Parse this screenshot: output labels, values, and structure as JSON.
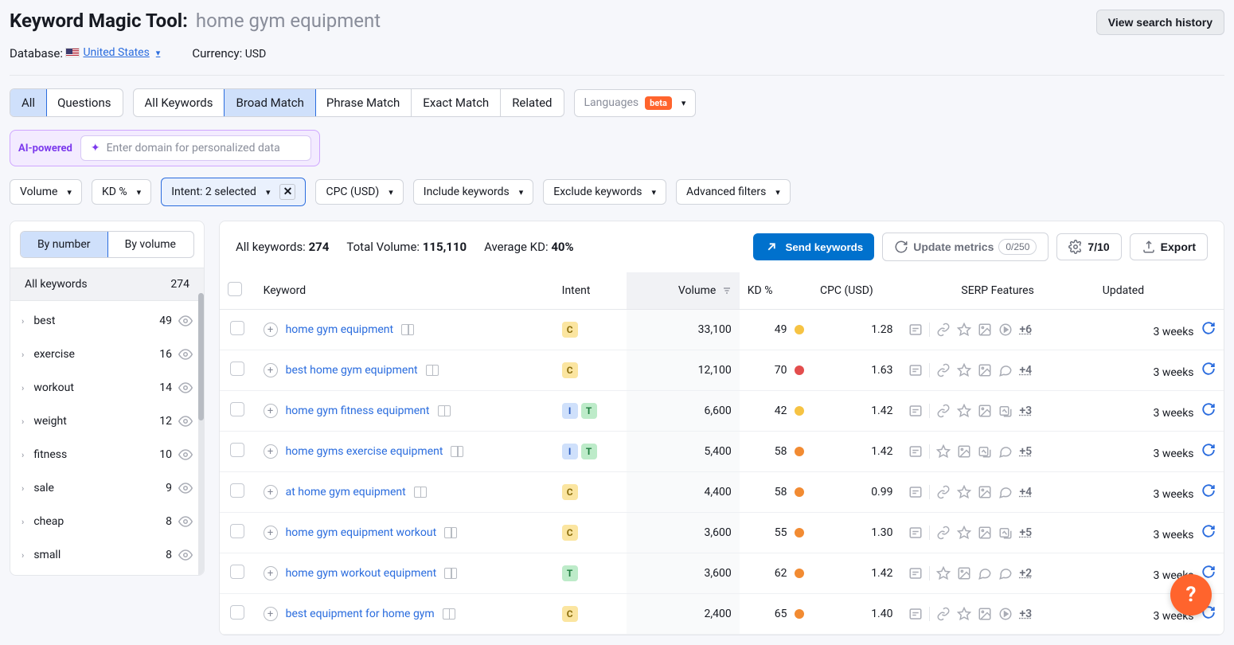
{
  "header": {
    "tool_name": "Keyword Magic Tool:",
    "query": "home gym equipment",
    "view_history": "View search history",
    "database_label": "Database:",
    "database_value": "United States",
    "currency_label": "Currency:",
    "currency_value": "USD"
  },
  "tabs": {
    "scope": [
      "All",
      "Questions"
    ],
    "scope_active": 0,
    "match": [
      "All Keywords",
      "Broad Match",
      "Phrase Match",
      "Exact Match",
      "Related"
    ],
    "match_active": 1,
    "languages": "Languages",
    "beta": "beta"
  },
  "ai": {
    "label": "AI-powered",
    "placeholder": "Enter domain for personalized data"
  },
  "filters": {
    "volume": "Volume",
    "kd": "KD %",
    "intent": "Intent: 2 selected",
    "cpc": "CPC (USD)",
    "include": "Include keywords",
    "exclude": "Exclude keywords",
    "advanced": "Advanced filters"
  },
  "sidebar": {
    "by_number": "By number",
    "by_volume": "By volume",
    "view_active": "number",
    "all_keywords_label": "All keywords",
    "all_keywords_count": "274",
    "groups": [
      {
        "name": "best",
        "count": "49"
      },
      {
        "name": "exercise",
        "count": "16"
      },
      {
        "name": "workout",
        "count": "14"
      },
      {
        "name": "weight",
        "count": "12"
      },
      {
        "name": "fitness",
        "count": "10"
      },
      {
        "name": "sale",
        "count": "9"
      },
      {
        "name": "cheap",
        "count": "8"
      },
      {
        "name": "small",
        "count": "8"
      }
    ]
  },
  "summary": {
    "all_kw_label": "All keywords:",
    "all_kw_value": "274",
    "total_vol_label": "Total Volume:",
    "total_vol_value": "115,110",
    "avg_kd_label": "Average KD:",
    "avg_kd_value": "40%",
    "send": "Send keywords",
    "update": "Update metrics",
    "update_count": "0/250",
    "ratio": "7/10",
    "export": "Export"
  },
  "columns": {
    "keyword": "Keyword",
    "intent": "Intent",
    "volume": "Volume",
    "kd": "KD %",
    "cpc": "CPC (USD)",
    "serp": "SERP Features",
    "updated": "Updated"
  },
  "rows": [
    {
      "kw": "home gym equipment",
      "intent": [
        "C"
      ],
      "volume": "33,100",
      "kd": "49",
      "kd_color": "yellow",
      "cpc": "1.28",
      "serp_icons": [
        "link",
        "star",
        "image",
        "play"
      ],
      "serp_more": "+6",
      "updated": "3 weeks"
    },
    {
      "kw": "best home gym equipment",
      "intent": [
        "C"
      ],
      "volume": "12,100",
      "kd": "70",
      "kd_color": "red",
      "cpc": "1.63",
      "serp_icons": [
        "link",
        "star",
        "image",
        "comment"
      ],
      "serp_more": "+4",
      "updated": "3 weeks"
    },
    {
      "kw": "home gym fitness equipment",
      "intent": [
        "I",
        "T"
      ],
      "volume": "6,600",
      "kd": "42",
      "kd_color": "yellow",
      "cpc": "1.42",
      "serp_icons": [
        "link",
        "star",
        "image",
        "gallery"
      ],
      "serp_more": "+3",
      "updated": "3 weeks"
    },
    {
      "kw": "home gyms exercise equipment",
      "intent": [
        "I",
        "T"
      ],
      "volume": "5,400",
      "kd": "58",
      "kd_color": "orange",
      "cpc": "1.42",
      "serp_icons": [
        "star",
        "image",
        "gallery",
        "comment"
      ],
      "serp_more": "+5",
      "updated": "3 weeks"
    },
    {
      "kw": "at home gym equipment",
      "intent": [
        "C"
      ],
      "volume": "4,400",
      "kd": "58",
      "kd_color": "orange",
      "cpc": "0.99",
      "serp_icons": [
        "link",
        "star",
        "image",
        "comment"
      ],
      "serp_more": "+4",
      "updated": "3 weeks"
    },
    {
      "kw": "home gym equipment workout",
      "intent": [
        "C"
      ],
      "volume": "3,600",
      "kd": "55",
      "kd_color": "orange",
      "cpc": "1.30",
      "serp_icons": [
        "link",
        "star",
        "image",
        "gallery"
      ],
      "serp_more": "+5",
      "updated": "3 weeks"
    },
    {
      "kw": "home gym workout equipment",
      "intent": [
        "T"
      ],
      "volume": "3,600",
      "kd": "62",
      "kd_color": "orange",
      "cpc": "1.42",
      "serp_icons": [
        "star",
        "image",
        "comment",
        "comment"
      ],
      "serp_more": "+2",
      "updated": "3 weeks"
    },
    {
      "kw": "best equipment for home gym",
      "intent": [
        "C"
      ],
      "volume": "2,400",
      "kd": "65",
      "kd_color": "orange",
      "cpc": "1.40",
      "serp_icons": [
        "link",
        "star",
        "image",
        "play"
      ],
      "serp_more": "+3",
      "updated": "3 weeks"
    }
  ],
  "icons": {
    "chevron_down": "▾",
    "chevron_right": "›",
    "sort": "≡"
  }
}
